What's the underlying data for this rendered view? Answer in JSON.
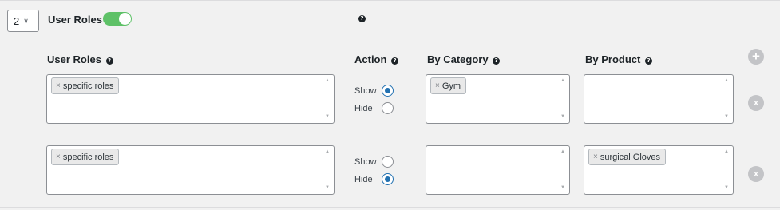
{
  "header": {
    "rule_number": "2",
    "title": "User Roles",
    "toggle_on": true
  },
  "columns": {
    "user_roles": "User Roles",
    "action": "Action",
    "by_category": "By Category",
    "by_product": "By Product"
  },
  "rows": [
    {
      "roles_tag": "specific roles",
      "action_show": "Show",
      "action_hide": "Hide",
      "selected_action": "show",
      "category_tag": "Gym",
      "product_tag": ""
    },
    {
      "roles_tag": "specific roles",
      "action_show": "Show",
      "action_hide": "Hide",
      "selected_action": "hide",
      "category_tag": "",
      "product_tag": "surgical Gloves"
    }
  ],
  "icons": {
    "help": "?",
    "add": "+",
    "remove": "x",
    "tag_remove": "×",
    "chevron": "∨",
    "scroll_up": "▲",
    "scroll_down": "▼"
  },
  "colors": {
    "toggle_on": "#5ec167",
    "radio_selected": "#2271b1",
    "circle_button": "#c3c4c7"
  }
}
